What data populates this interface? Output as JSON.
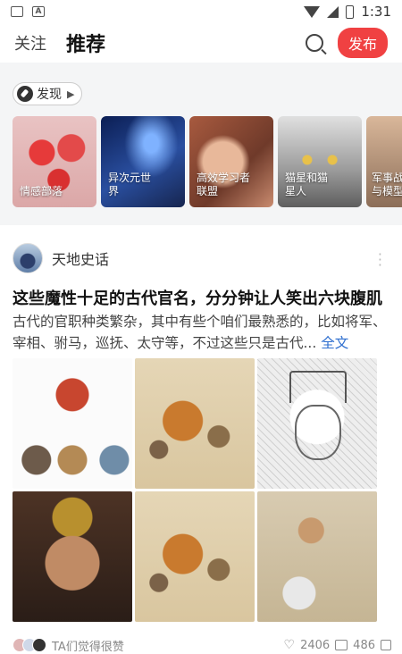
{
  "status_bar": {
    "time": "1:31"
  },
  "top_nav": {
    "tabs": [
      "关注",
      "推荐"
    ],
    "active_tab": "推荐",
    "publish_label": "发布"
  },
  "discover": {
    "chip_label": "发现",
    "cards": [
      {
        "label": "情感部落"
      },
      {
        "label": "异次元世界"
      },
      {
        "label": "高效学习者联盟"
      },
      {
        "label": "猫星和猫星人"
      },
      {
        "label": "军事战与模型"
      }
    ]
  },
  "post": {
    "author": "天地史话",
    "title": "这些魔性十足的古代官名，分分钟让人笑出六块腹肌",
    "summary": "古代的官职种类繁杂，其中有些个咱们最熟悉的，比如将军、宰相、驸马，巡抚、太守等，不过这些只是古代...",
    "full_text_link": "全文",
    "footer": {
      "liked_by_text": "TA们觉得很赞",
      "likes": "2406",
      "comments": "486"
    }
  },
  "colors": {
    "accent": "#f04142",
    "link": "#2f6fcf"
  }
}
